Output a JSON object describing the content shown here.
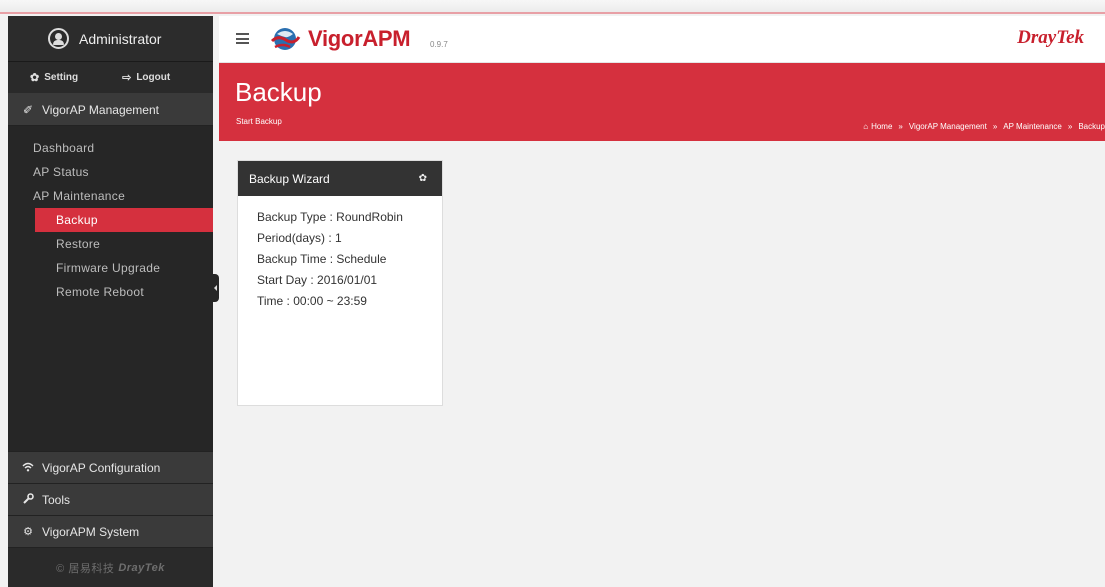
{
  "sidebar": {
    "user": "Administrator",
    "setting_label": "Setting",
    "logout_label": "Logout",
    "section_management": "VigorAP Management",
    "items": [
      {
        "label": "Dashboard"
      },
      {
        "label": "AP Status"
      },
      {
        "label": "AP Maintenance"
      },
      {
        "label": "Backup"
      },
      {
        "label": "Restore"
      },
      {
        "label": "Firmware Upgrade"
      },
      {
        "label": "Remote Reboot"
      }
    ],
    "section_configuration": "VigorAP Configuration",
    "section_tools": "Tools",
    "section_system": "VigorAPM System",
    "copyright_prefix": "© 居易科技",
    "copyright_brand": "DrayTek"
  },
  "header": {
    "app_name": "VigorAPM",
    "version": "0.9.7",
    "brand_dray": "Dray",
    "brand_tek": "Tek"
  },
  "banner": {
    "title": "Backup",
    "subtitle": "Start Backup",
    "breadcrumbs": [
      "Home",
      "VigorAP Management",
      "AP Maintenance",
      "Backup"
    ]
  },
  "card": {
    "title": "Backup Wizard",
    "lines": [
      "Backup Type : RoundRobin",
      "Period(days) : 1",
      "Backup Time : Schedule",
      "Start Day : 2016/01/01",
      "Time : 00:00 ~ 23:59"
    ]
  },
  "colors": {
    "accent_red": "#d5303e",
    "sidebar_bg": "#262626",
    "card_header_bg": "#333333"
  }
}
